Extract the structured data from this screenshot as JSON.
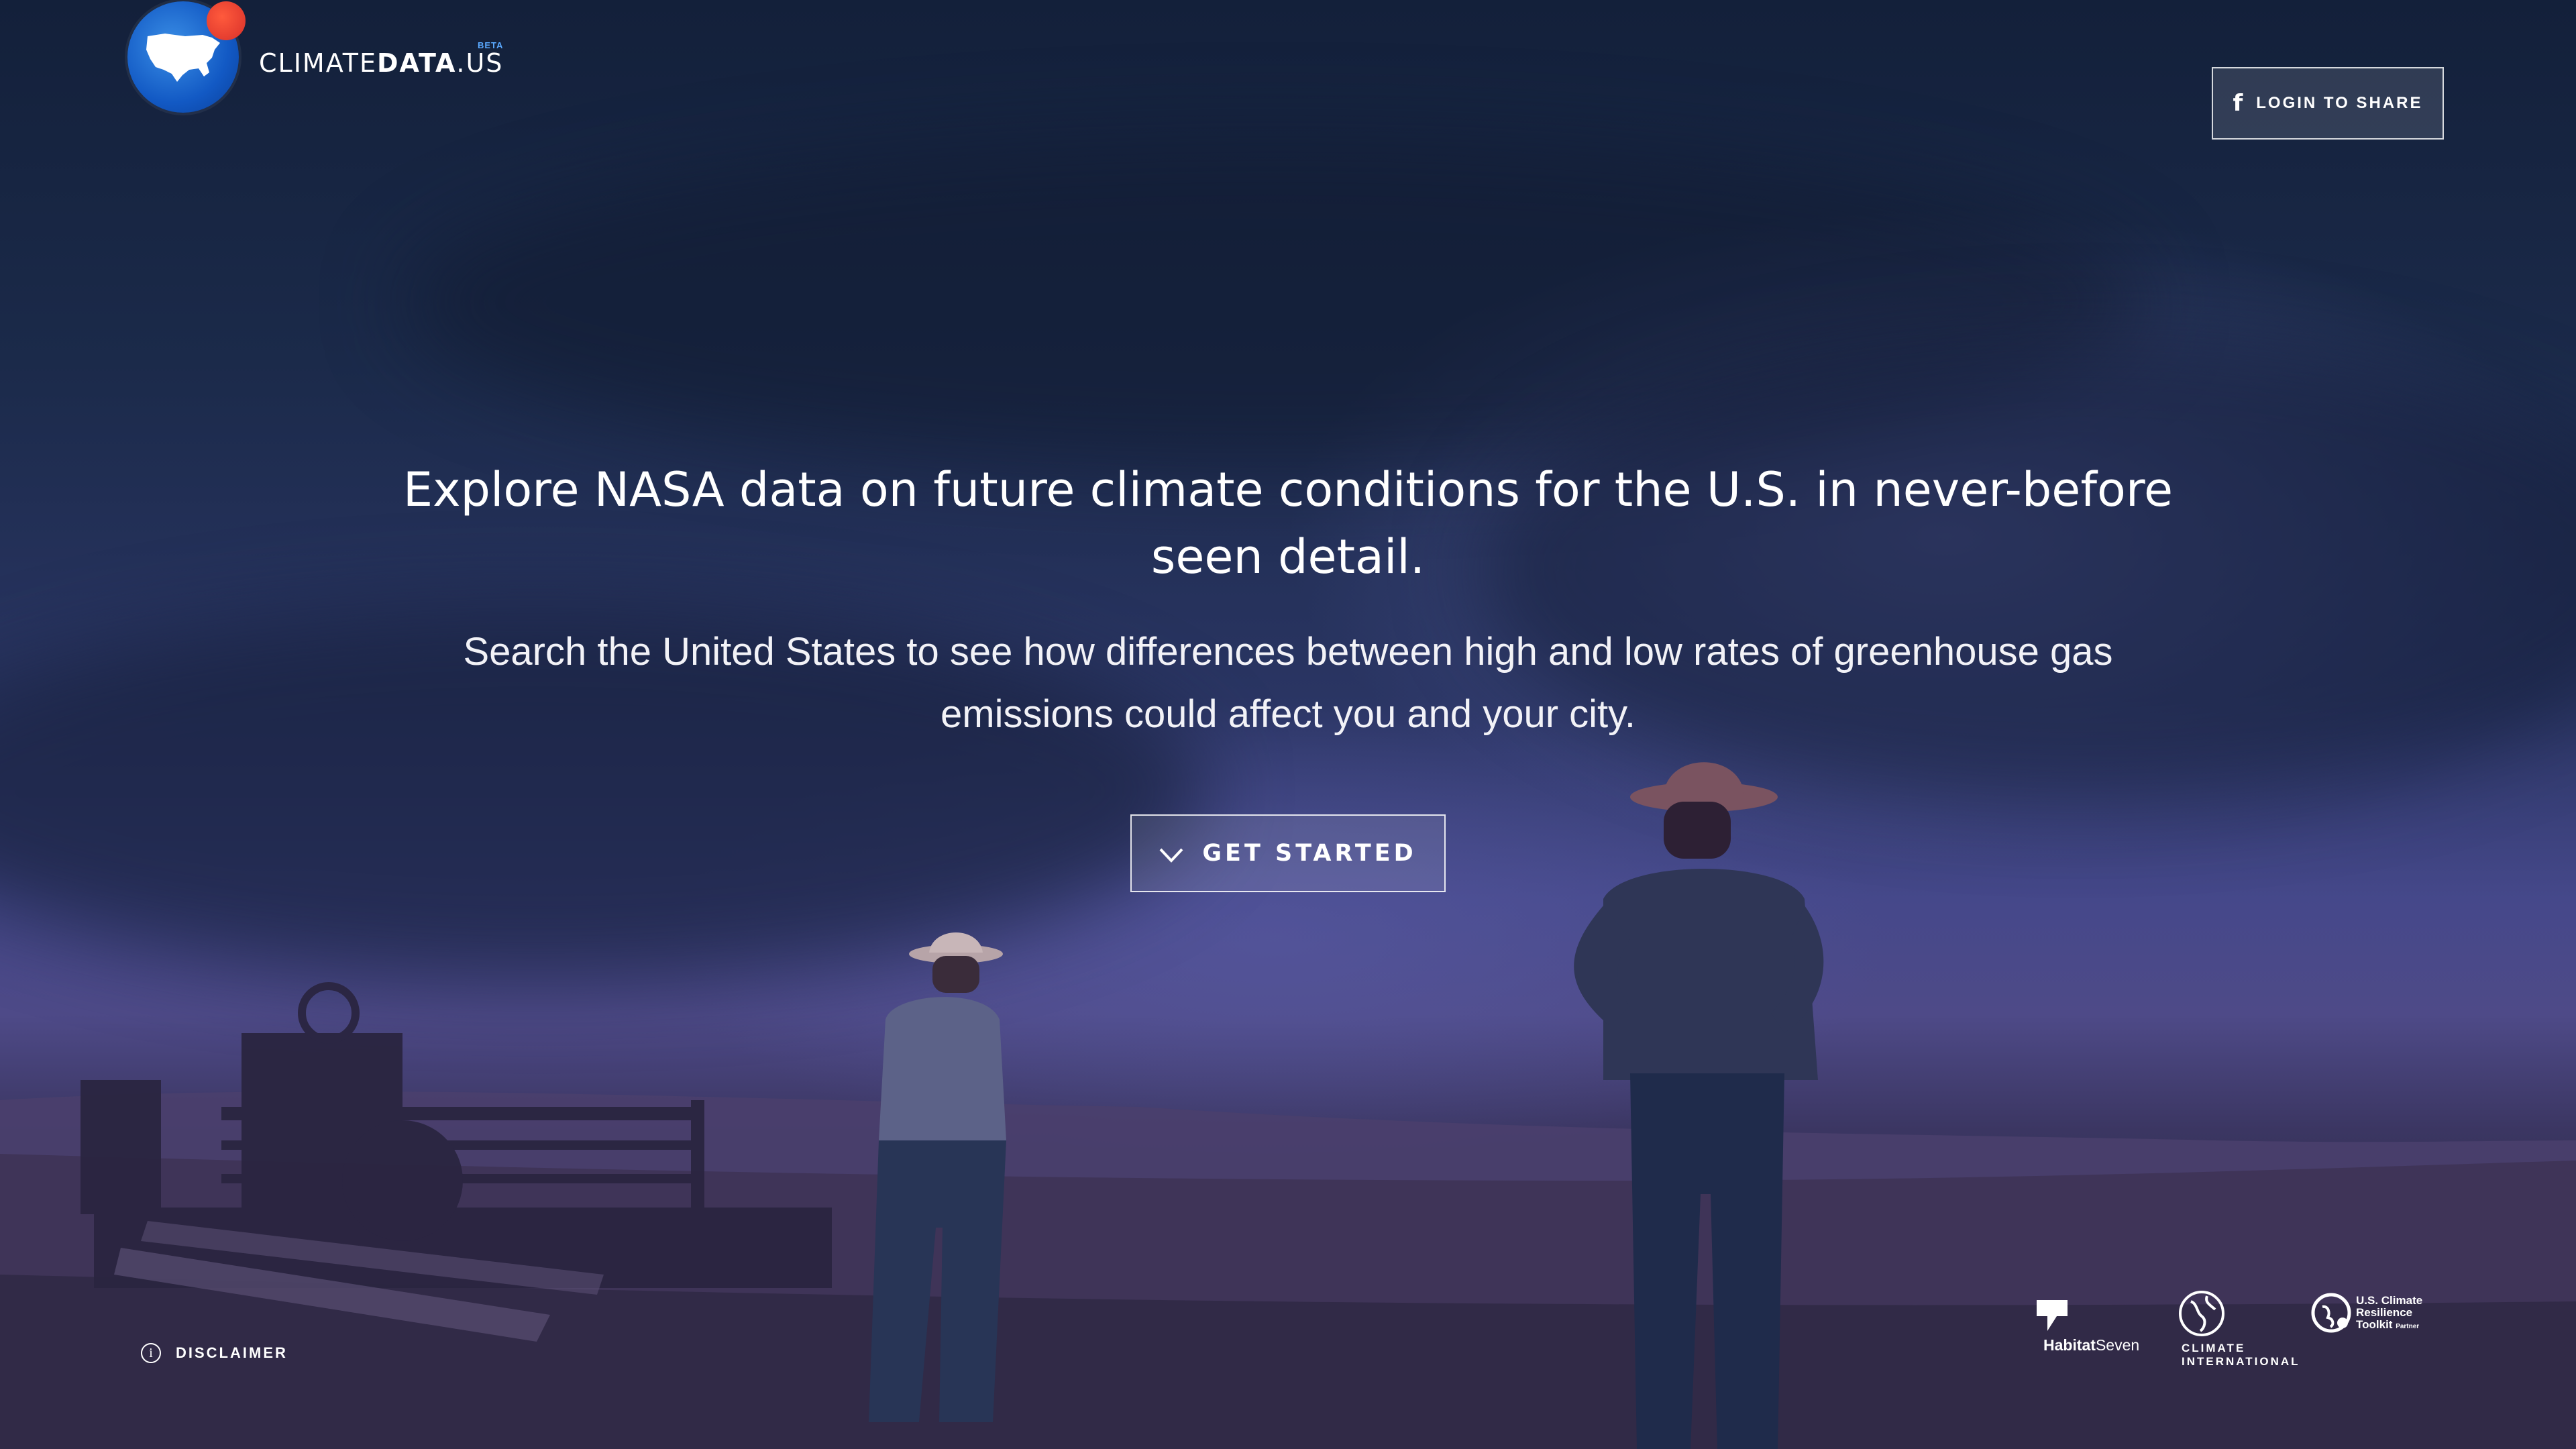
{
  "brand": {
    "name_part1": "CLIMATE",
    "name_part2": "DATA",
    "name_part3": ".US",
    "badge": "BETA",
    "logo_icon": "us-map-globe-icon"
  },
  "header": {
    "login_button": {
      "icon": "facebook-icon",
      "label": "LOGIN TO SHARE"
    }
  },
  "hero": {
    "headline": "Explore NASA data on future climate conditions for the U.S. in never-before seen detail.",
    "subheadline": "Search the United States to see how differences between high and low rates of greenhouse gas emissions could affect you and your city.",
    "cta": {
      "icon": "chevron-down-icon",
      "label": "GET STARTED"
    }
  },
  "footer": {
    "disclaimer": {
      "icon": "info-icon",
      "label": "DISCLAIMER"
    },
    "partners": [
      {
        "name_bold": "Habitat",
        "name_light": "Seven",
        "icon": "habitat-seven-icon"
      },
      {
        "name_line1": "CLIMATE",
        "name_line2": "INTERNATIONAL",
        "icon": "globe-icon"
      },
      {
        "name_line1": "U.S. Climate",
        "name_line2": "Resilience",
        "name_line3": "Toolkit",
        "tag": "Partner",
        "icon": "toolkit-globe-icon"
      }
    ]
  },
  "colors": {
    "sky_top": "#13203a",
    "sky_mid": "#2a3563",
    "horizon": "#4e4a88",
    "ground": "#2c2948",
    "logo_blue": "#1259c4",
    "logo_red": "#d8302a",
    "beta_blue": "#5aa9ff"
  }
}
